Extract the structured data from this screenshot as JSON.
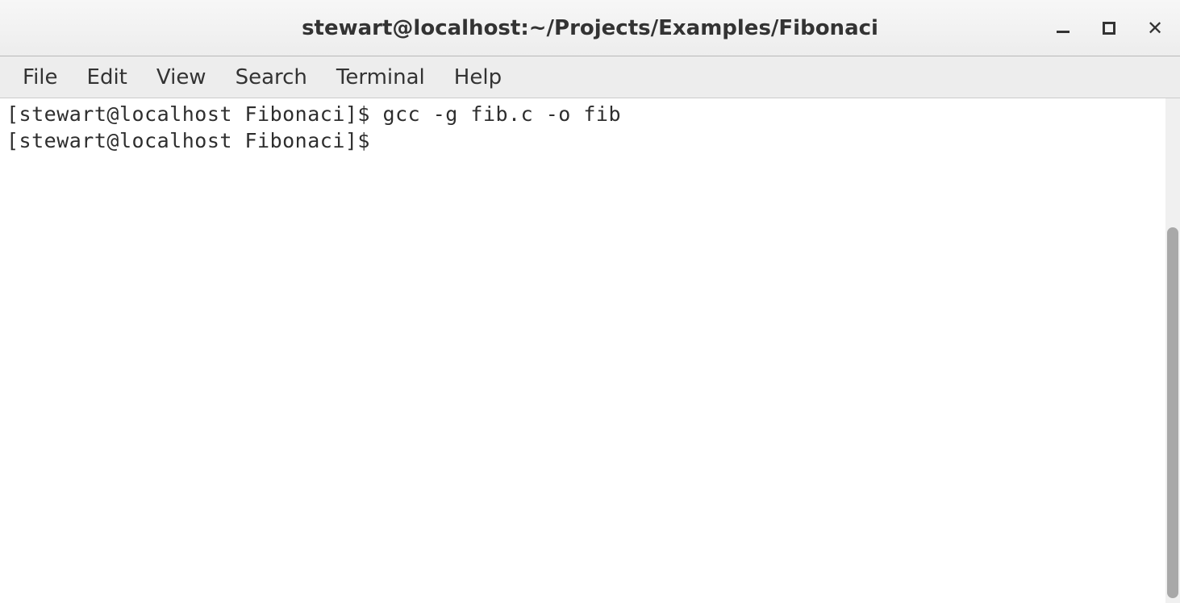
{
  "titlebar": {
    "title": "stewart@localhost:~/Projects/Examples/Fibonaci"
  },
  "menubar": {
    "items": [
      "File",
      "Edit",
      "View",
      "Search",
      "Terminal",
      "Help"
    ]
  },
  "terminal": {
    "lines": [
      {
        "prompt": "[stewart@localhost Fibonaci]$ ",
        "command": "gcc -g fib.c -o fib"
      },
      {
        "prompt": "[stewart@localhost Fibonaci]$ ",
        "command": ""
      }
    ]
  }
}
